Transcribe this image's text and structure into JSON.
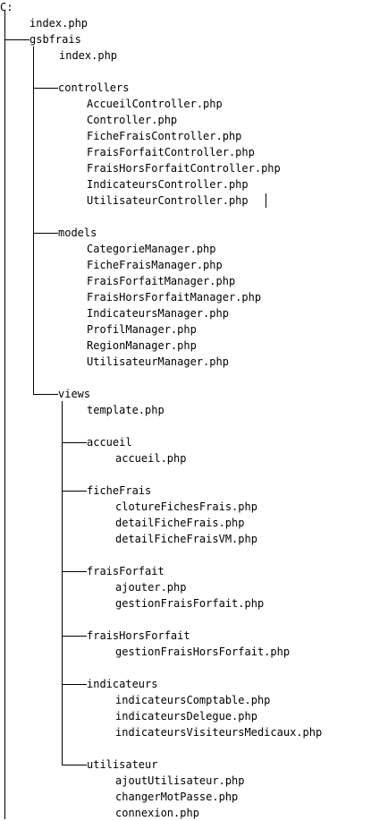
{
  "root": "C:",
  "root_files": [
    "index.php"
  ],
  "project": {
    "name": "gsbfrais",
    "files": [
      "index.php"
    ],
    "folders": [
      {
        "name": "controllers",
        "files": [
          "AccueilController.php",
          "Controller.php",
          "FicheFraisController.php",
          "FraisForfaitController.php",
          "FraisHorsForfaitController.php",
          "IndicateursController.php",
          "UtilisateurController.php"
        ]
      },
      {
        "name": "models",
        "files": [
          "CategorieManager.php",
          "FicheFraisManager.php",
          "FraisForfaitManager.php",
          "FraisHorsForfaitManager.php",
          "IndicateursManager.php",
          "ProfilManager.php",
          "RegionManager.php",
          "UtilisateurManager.php"
        ]
      },
      {
        "name": "views",
        "files": [
          "template.php"
        ],
        "folders": [
          {
            "name": "accueil",
            "files": [
              "accueil.php"
            ]
          },
          {
            "name": "ficheFrais",
            "files": [
              "clotureFichesFrais.php",
              "detailFicheFrais.php",
              "detailFicheFraisVM.php"
            ]
          },
          {
            "name": "fraisForfait",
            "files": [
              "ajouter.php",
              "gestionFraisForfait.php"
            ]
          },
          {
            "name": "fraisHorsForfait",
            "files": [
              "gestionFraisHorsForfait.php"
            ]
          },
          {
            "name": "indicateurs",
            "files": [
              "indicateursComptable.php",
              "indicateursDelegue.php",
              "indicateursVisiteursMedicaux.php"
            ]
          },
          {
            "name": "utilisateur",
            "files": [
              "ajoutUtilisateur.php",
              "changerMotPasse.php",
              "connexion.php"
            ]
          }
        ]
      }
    ]
  }
}
